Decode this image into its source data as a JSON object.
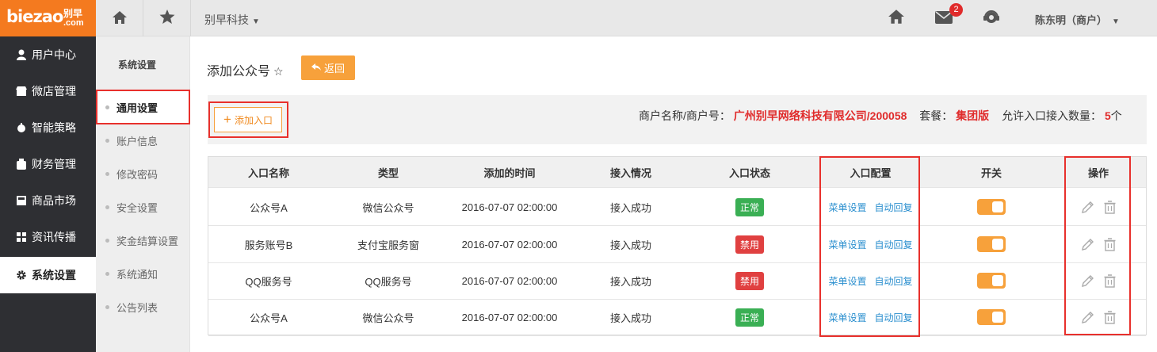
{
  "topbar": {
    "logo_main": "biezao",
    "logo_cn": "别早",
    "logo_com": ".com",
    "company": "别早科技",
    "mail_badge": "2",
    "user": "陈东明（商户）"
  },
  "sidebar": {
    "items": [
      {
        "label": "用户中心",
        "icon": "user-icon"
      },
      {
        "label": "微店管理",
        "icon": "shop-icon"
      },
      {
        "label": "智能策略",
        "icon": "strategy-icon"
      },
      {
        "label": "财务管理",
        "icon": "wallet-icon"
      },
      {
        "label": "商品市场",
        "icon": "market-icon"
      },
      {
        "label": "资讯传播",
        "icon": "grid-icon"
      },
      {
        "label": "系统设置",
        "icon": "gear-icon",
        "active": true
      }
    ]
  },
  "subbar": {
    "title": "系统设置",
    "items": [
      {
        "label": "通用设置",
        "active": true
      },
      {
        "label": "账户信息"
      },
      {
        "label": "修改密码"
      },
      {
        "label": "安全设置"
      },
      {
        "label": "奖金结算设置"
      },
      {
        "label": "系统通知"
      },
      {
        "label": "公告列表"
      }
    ]
  },
  "main": {
    "title": "添加公众号",
    "back_label": "返回",
    "add_label": "添加入口",
    "merchant_label": "商户名称/商户号：",
    "merchant_value": "广州别早网络科技有限公司/200058",
    "package_label": "套餐：",
    "package_value": "集团版",
    "quota_label": "允许入口接入数量：",
    "quota_value": "5",
    "quota_unit": "个"
  },
  "table": {
    "headers": [
      "入口名称",
      "类型",
      "添加的时间",
      "接入情况",
      "入口状态",
      "入口配置",
      "开关",
      "操作"
    ],
    "config_links": [
      "菜单设置",
      "自动回复"
    ],
    "rows": [
      {
        "name": "公众号A",
        "type": "微信公众号",
        "time": "2016-07-07 02:00:00",
        "access": "接入成功",
        "status": "正常",
        "status_kind": "ok"
      },
      {
        "name": "服务账号B",
        "type": "支付宝服务窗",
        "time": "2016-07-07 02:00:00",
        "access": "接入成功",
        "status": "禁用",
        "status_kind": "off"
      },
      {
        "name": "QQ服务号",
        "type": "QQ服务号",
        "time": "2016-07-07 02:00:00",
        "access": "接入成功",
        "status": "禁用",
        "status_kind": "off"
      },
      {
        "name": "公众号A",
        "type": "微信公众号",
        "time": "2016-07-07 02:00:00",
        "access": "接入成功",
        "status": "正常",
        "status_kind": "ok"
      }
    ]
  },
  "colors": {
    "accent": "#f7a13b",
    "logo_bg": "#f47a1f",
    "highlight": "#e8302c",
    "ok": "#3aaf54",
    "off": "#e04040",
    "link": "#2b8fcf"
  }
}
